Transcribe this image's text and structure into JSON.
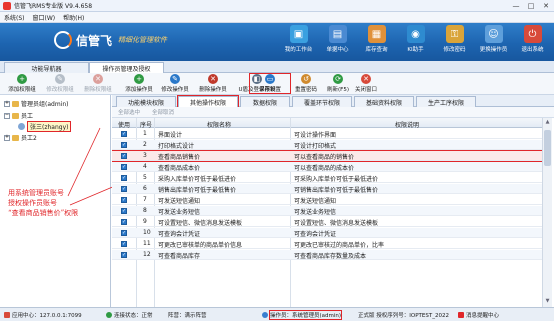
{
  "window": {
    "title": "信管飞RMS专业版 V9.4.658",
    "min": "—",
    "max": "□",
    "close": "✕"
  },
  "menubar": [
    "系统(S)",
    "窗口(W)",
    "帮助(H)"
  ],
  "banner": {
    "logo": "信管飞",
    "slogan": "精细化管理软件",
    "nav": [
      {
        "label": "我的工作台",
        "icon": "desk-icon",
        "glyph": "▣",
        "color": "#3aa0e0"
      },
      {
        "label": "单据中心",
        "icon": "documents-icon",
        "glyph": "▤",
        "color": "#4a8ad2"
      },
      {
        "label": "库存查询",
        "icon": "warehouse-icon",
        "glyph": "▦",
        "color": "#e0913a"
      },
      {
        "label": "KI助手",
        "icon": "ki-assistant-icon",
        "glyph": "◉",
        "color": "#2e8bd0"
      },
      {
        "label": "修改密码",
        "icon": "key-icon",
        "glyph": "⚿",
        "color": "#d9a43a"
      },
      {
        "label": "更换操作员",
        "icon": "user-switch-icon",
        "glyph": "☺",
        "color": "#5e9fdb"
      },
      {
        "label": "退出系统",
        "icon": "exit-icon",
        "glyph": "⏻",
        "color": "#d84a3a"
      }
    ]
  },
  "tabs": [
    "功能导航器",
    "操作员管理及授权"
  ],
  "toolbar": [
    {
      "label": "添加权限组",
      "icon": "add-group-icon",
      "glyph": "+",
      "color": "#2f9a43",
      "disabled": false
    },
    {
      "label": "修改权限组",
      "icon": "edit-group-icon",
      "glyph": "✎",
      "color": "#6b7b8c",
      "disabled": true
    },
    {
      "label": "删除权限组",
      "icon": "delete-group-icon",
      "glyph": "✕",
      "color": "#c0392b",
      "disabled": true
    },
    {
      "label": "添加操作员",
      "icon": "add-operator-icon",
      "glyph": "+",
      "color": "#2f9a43",
      "disabled": false
    },
    {
      "label": "修改操作员",
      "icon": "edit-operator-icon",
      "glyph": "✎",
      "color": "#2a78c9",
      "disabled": false
    },
    {
      "label": "删除操作员",
      "icon": "delete-operator-icon",
      "glyph": "✕",
      "color": "#c0392b",
      "disabled": false
    },
    {
      "label": "U盾及登录限制",
      "icon": "usb-key-icon",
      "glyph": "◧",
      "color": "#5b6f86",
      "disabled": false
    },
    {
      "label": "保存设置",
      "icon": "save-icon",
      "glyph": "▭",
      "color": "#2a78c9",
      "disabled": false
    },
    {
      "label": "重置密码",
      "icon": "reset-password-icon",
      "glyph": "↺",
      "color": "#d08a2e",
      "disabled": false
    },
    {
      "label": "刷新(F5)",
      "icon": "refresh-icon",
      "glyph": "⟳",
      "color": "#2f9a43",
      "disabled": false
    },
    {
      "label": "关闭窗口",
      "icon": "close-window-icon",
      "glyph": "✕",
      "color": "#d84a3a",
      "disabled": false
    }
  ],
  "tree": {
    "admin_group": "管理员组(admin)",
    "staff": "员工",
    "selected_user": "张三(zhangy)",
    "staff2": "员工2",
    "toggle_open": "−",
    "toggle_closed": "+"
  },
  "annotation": [
    "用系统管理员账号",
    "授权操作员账号",
    "“查看商品销售价”权限"
  ],
  "subtabs": [
    "功能模块权限",
    "其他操作权限",
    "数据权限",
    "覆盖环节权限",
    "基础资料权限",
    "生产工序权限"
  ],
  "selbar": [
    "全部选中",
    "全部取消"
  ],
  "grid": {
    "headers": [
      "使用",
      "序号",
      "权限名称",
      "权限说明"
    ],
    "check_glyph": "✓",
    "rows": [
      {
        "no": "1",
        "name": "界面设计",
        "desc": "可设计操作界面"
      },
      {
        "no": "2",
        "name": "打印格式设计",
        "desc": "可设计打印格式"
      },
      {
        "no": "3",
        "name": "查看商品销售价",
        "desc": "可以查看商品的销售价"
      },
      {
        "no": "4",
        "name": "查看商品成本价",
        "desc": "可以查看商品的成本价"
      },
      {
        "no": "5",
        "name": "采购入库单价可低于最低进价",
        "desc": "可采购入库单价可低于最低进价"
      },
      {
        "no": "6",
        "name": "销售出库单价可低于最低售价",
        "desc": "可销售出库单价可低于最低售价"
      },
      {
        "no": "7",
        "name": "可发送短信通知",
        "desc": "可发送短信通知"
      },
      {
        "no": "8",
        "name": "可发送业务短信",
        "desc": "可发送业务短信"
      },
      {
        "no": "9",
        "name": "可设置短信、微信消息发送模板",
        "desc": "可设置短信、微信消息发送模板"
      },
      {
        "no": "10",
        "name": "可查询会计凭证",
        "desc": "可查询会计凭证"
      },
      {
        "no": "11",
        "name": "可更改已审核单的商品单价信息",
        "desc": "可更改已审核过的商品单价，比率"
      },
      {
        "no": "12",
        "name": "可查看商品库存",
        "desc": "可查看商品库存数量及成本"
      }
    ]
  },
  "status": {
    "app_center": "应用中心：127.0.0.1:7099",
    "conn": "连接状态：正常",
    "mode": "阵营：满示阵营",
    "operator": "操作员：系统管理员(admin)",
    "license": "正式版 授权序列号：IOPTEST_2022",
    "message": "消息提醒中心"
  }
}
